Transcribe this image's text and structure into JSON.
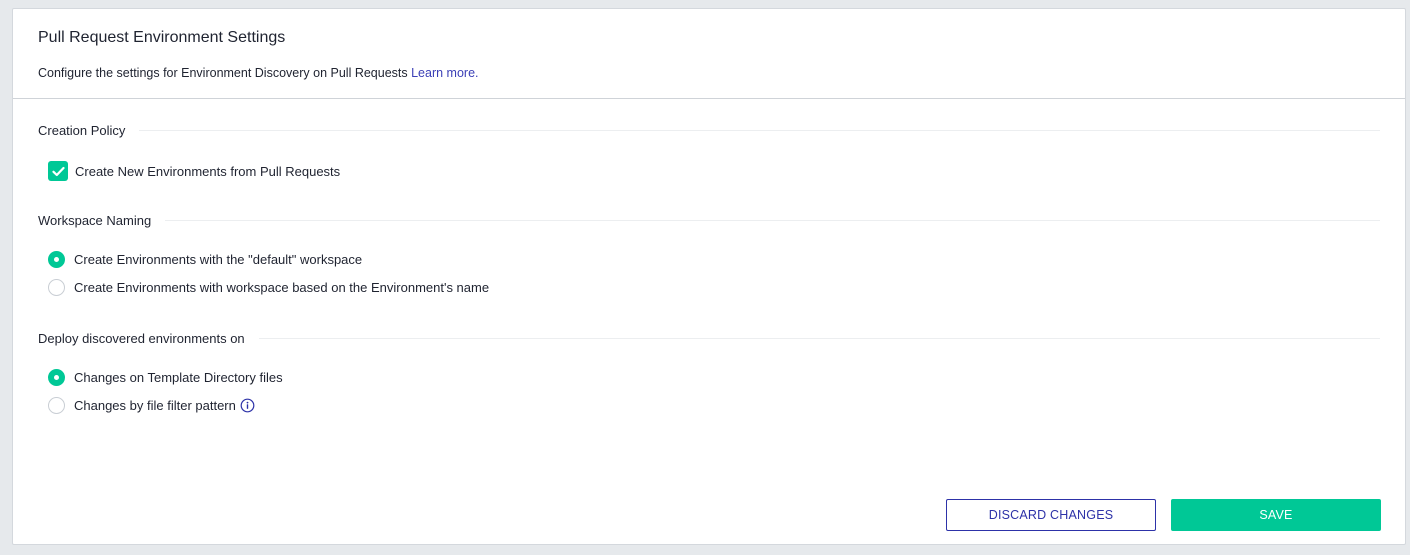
{
  "header": {
    "title": "Pull Request Environment Settings",
    "description": "Configure the settings for Environment Discovery on Pull Requests",
    "learn_more": "Learn more."
  },
  "creation_policy": {
    "title": "Creation Policy",
    "checkbox_label": "Create New Environments from Pull Requests",
    "checked": true
  },
  "workspace_naming": {
    "title": "Workspace Naming",
    "options": [
      {
        "label": "Create Environments with the \"default\" workspace",
        "selected": true
      },
      {
        "label": "Create Environments with workspace based on the Environment's name",
        "selected": false
      }
    ]
  },
  "deploy": {
    "title": "Deploy discovered environments on",
    "options": [
      {
        "label": "Changes on Template Directory files",
        "selected": true
      },
      {
        "label": "Changes by file filter pattern",
        "selected": false
      }
    ]
  },
  "actions": {
    "discard_label": "DISCARD CHANGES",
    "save_label": "SAVE"
  },
  "colors": {
    "accent": "#00c896",
    "primary": "#2d32a8",
    "link": "#3b3fb6"
  },
  "icons": {
    "checkbox": "checkmark-icon",
    "info": "info-icon"
  }
}
